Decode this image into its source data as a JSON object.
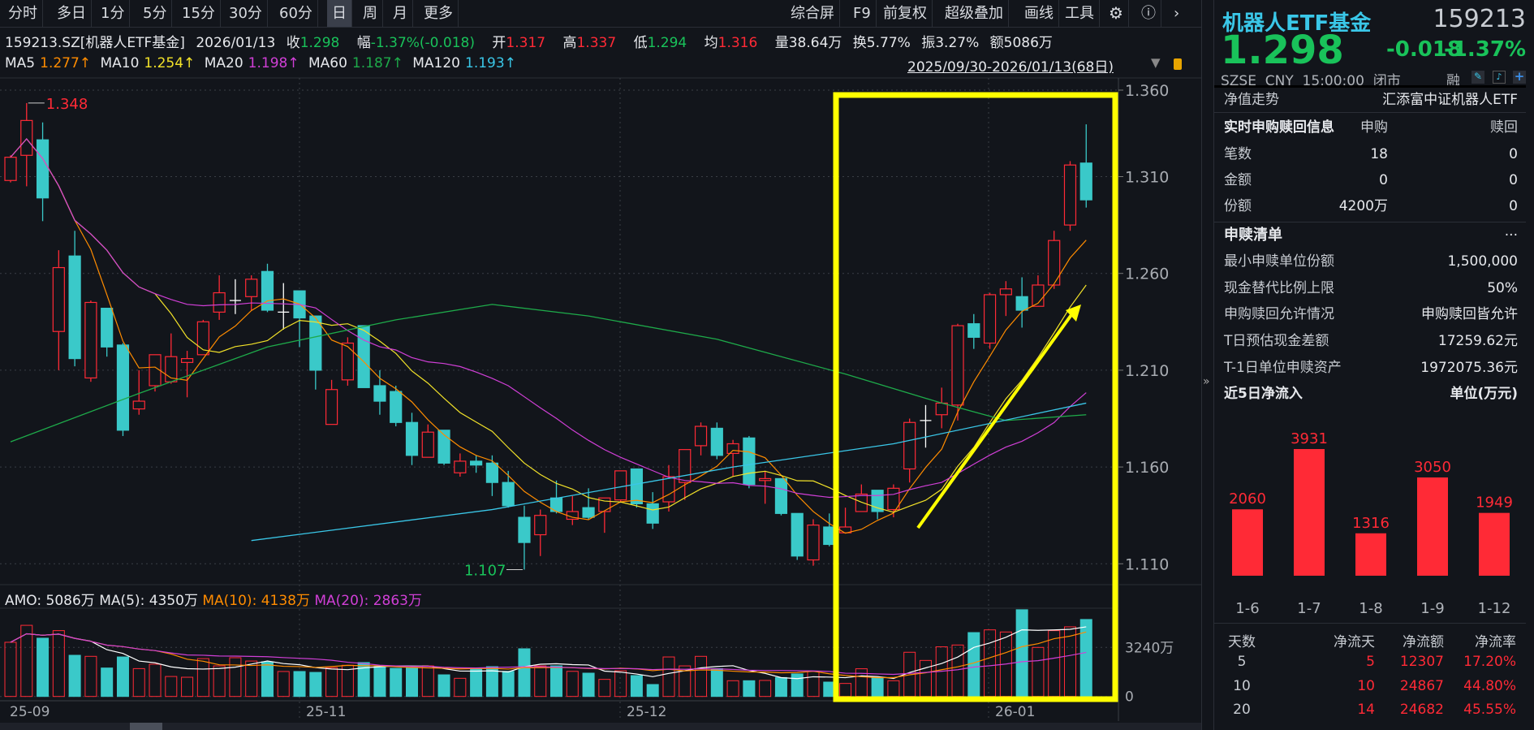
{
  "toolbar": {
    "left": [
      "分时",
      "多日",
      "1分",
      "5分",
      "15分",
      "30分",
      "60分",
      "日",
      "周",
      "月",
      "更多"
    ],
    "active": "日",
    "right": [
      "综合屏",
      "F9",
      "前复权",
      "超级叠加",
      "画线",
      "工具"
    ],
    "icons": [
      "gear-icon",
      "help-icon",
      "chevron-right-icon"
    ]
  },
  "info": {
    "code": "159213.SZ[机器人ETF基金]",
    "date": "2026/01/13",
    "close_label": "收",
    "close": "1.298",
    "chg_label": "幅",
    "chg": "-1.37%(-0.018)",
    "open_label": "开",
    "open": "1.317",
    "high_label": "高",
    "high": "1.337",
    "low_label": "低",
    "low": "1.294",
    "avg_label": "均",
    "avg": "1.316",
    "vol": "量38.64万",
    "turnover": "换5.77%",
    "amp": "振3.27%",
    "amount": "额5086万"
  },
  "ma": {
    "ma5_label": "MA5",
    "ma5": "1.277↑",
    "ma10_label": "MA10",
    "ma10": "1.254↑",
    "ma20_label": "MA20",
    "ma20": "1.198↑",
    "ma60_label": "MA60",
    "ma60": "1.187↑",
    "ma120_label": "MA120",
    "ma120": "1.193↑",
    "range": "2025/09/30-2026/01/13(68日)"
  },
  "colors": {
    "up": "#ff2a36",
    "down": "#3ac9c9",
    "ma5": "#ff8c00",
    "ma10": "#f2e229",
    "ma20": "#d03fd6",
    "ma60": "#1eaa4a",
    "ma120": "#3ac7e8",
    "highlight": "#ffff00"
  },
  "chart_data": {
    "type": "candlestick",
    "price_axis": {
      "ticks": [
        "1.360",
        "1.310",
        "1.260",
        "1.210",
        "1.160",
        "1.110"
      ]
    },
    "high_mark": "1.348",
    "low_mark": "1.107",
    "date_ticks": [
      {
        "label": "25-09",
        "index": 0
      },
      {
        "label": "25-11",
        "index": 18
      },
      {
        "label": "25-12",
        "index": 38
      },
      {
        "label": "26-01",
        "index": 61
      }
    ],
    "ohlc": [
      [
        1.308,
        1.321,
        1.307,
        1.32
      ],
      [
        1.321,
        1.348,
        1.305,
        1.339
      ],
      [
        1.329,
        1.338,
        1.287,
        1.299
      ],
      [
        1.23,
        1.272,
        1.21,
        1.263
      ],
      [
        1.269,
        1.282,
        1.212,
        1.216
      ],
      [
        1.206,
        1.246,
        1.204,
        1.245
      ],
      [
        1.242,
        1.242,
        1.217,
        1.222
      ],
      [
        1.223,
        1.224,
        1.176,
        1.179
      ],
      [
        1.19,
        1.21,
        1.187,
        1.194
      ],
      [
        1.202,
        1.218,
        1.199,
        1.218
      ],
      [
        1.204,
        1.229,
        1.203,
        1.217
      ],
      [
        1.214,
        1.22,
        1.196,
        1.216
      ],
      [
        1.218,
        1.236,
        1.218,
        1.235
      ],
      [
        1.24,
        1.259,
        1.236,
        1.25
      ],
      [
        1.246,
        1.257,
        1.239,
        1.246
      ],
      [
        1.248,
        1.259,
        1.241,
        1.257
      ],
      [
        1.261,
        1.265,
        1.24,
        1.241
      ],
      [
        1.24,
        1.255,
        1.231,
        1.24
      ],
      [
        1.251,
        1.251,
        1.222,
        1.237
      ],
      [
        1.238,
        1.238,
        1.2,
        1.21
      ],
      [
        1.182,
        1.205,
        1.182,
        1.2
      ],
      [
        1.205,
        1.227,
        1.202,
        1.224
      ],
      [
        1.233,
        1.233,
        1.201,
        1.201
      ],
      [
        1.202,
        1.21,
        1.187,
        1.194
      ],
      [
        1.199,
        1.202,
        1.181,
        1.183
      ],
      [
        1.183,
        1.188,
        1.161,
        1.166
      ],
      [
        1.165,
        1.182,
        1.165,
        1.178
      ],
      [
        1.179,
        1.179,
        1.161,
        1.162
      ],
      [
        1.157,
        1.167,
        1.155,
        1.163
      ],
      [
        1.163,
        1.166,
        1.157,
        1.161
      ],
      [
        1.162,
        1.166,
        1.145,
        1.152
      ],
      [
        1.152,
        1.158,
        1.139,
        1.14
      ],
      [
        1.134,
        1.14,
        1.107,
        1.121
      ],
      [
        1.125,
        1.138,
        1.114,
        1.135
      ],
      [
        1.144,
        1.153,
        1.136,
        1.137
      ],
      [
        1.133,
        1.145,
        1.13,
        1.137
      ],
      [
        1.139,
        1.149,
        1.133,
        1.134
      ],
      [
        1.137,
        1.144,
        1.126,
        1.144
      ],
      [
        1.143,
        1.158,
        1.142,
        1.158
      ],
      [
        1.159,
        1.159,
        1.139,
        1.141
      ],
      [
        1.141,
        1.147,
        1.128,
        1.131
      ],
      [
        1.142,
        1.161,
        1.137,
        1.155
      ],
      [
        1.152,
        1.169,
        1.143,
        1.169
      ],
      [
        1.171,
        1.183,
        1.166,
        1.181
      ],
      [
        1.18,
        1.183,
        1.164,
        1.166
      ],
      [
        1.167,
        1.174,
        1.155,
        1.172
      ],
      [
        1.175,
        1.176,
        1.149,
        1.151
      ],
      [
        1.153,
        1.158,
        1.141,
        1.154
      ],
      [
        1.154,
        1.154,
        1.135,
        1.136
      ],
      [
        1.136,
        1.136,
        1.112,
        1.114
      ],
      [
        1.112,
        1.133,
        1.109,
        1.13
      ],
      [
        1.129,
        1.136,
        1.119,
        1.12
      ],
      [
        1.126,
        1.139,
        1.126,
        1.129
      ],
      [
        1.137,
        1.151,
        1.137,
        1.146
      ],
      [
        1.148,
        1.148,
        1.133,
        1.137
      ],
      [
        1.138,
        1.151,
        1.134,
        1.149
      ],
      [
        1.159,
        1.185,
        1.152,
        1.183
      ],
      [
        1.184,
        1.192,
        1.17,
        1.184
      ],
      [
        1.187,
        1.201,
        1.18,
        1.193
      ],
      [
        1.192,
        1.234,
        1.184,
        1.233
      ],
      [
        1.234,
        1.239,
        1.221,
        1.227
      ],
      [
        1.224,
        1.25,
        1.221,
        1.249
      ],
      [
        1.249,
        1.256,
        1.238,
        1.252
      ],
      [
        1.248,
        1.258,
        1.232,
        1.241
      ],
      [
        1.243,
        1.259,
        1.243,
        1.254
      ],
      [
        1.254,
        1.282,
        1.252,
        1.277
      ],
      [
        1.285,
        1.318,
        1.282,
        1.316
      ],
      [
        1.317,
        1.337,
        1.294,
        1.298
      ]
    ],
    "ma60": [
      [
        0,
        1.173
      ],
      [
        8,
        1.198
      ],
      [
        16,
        1.222
      ],
      [
        24,
        1.236
      ],
      [
        30,
        1.244
      ],
      [
        36,
        1.238
      ],
      [
        44,
        1.226
      ],
      [
        52,
        1.208
      ],
      [
        58,
        1.193
      ],
      [
        62,
        1.184
      ],
      [
        67,
        1.187
      ]
    ],
    "ma120": [
      [
        15,
        1.122
      ],
      [
        30,
        1.138
      ],
      [
        45,
        1.16
      ],
      [
        55,
        1.172
      ],
      [
        67,
        1.193
      ]
    ],
    "volume_wan": [
      3580,
      4700,
      3850,
      4350,
      2720,
      2650,
      1880,
      2610,
      1840,
      2130,
      1320,
      1270,
      2500,
      2020,
      2560,
      2340,
      2290,
      1650,
      1650,
      1590,
      1900,
      2060,
      2240,
      2020,
      1860,
      1880,
      2020,
      1430,
      1200,
      1840,
      1970,
      1660,
      3150,
      2020,
      2020,
      1660,
      1540,
      1130,
      1700,
      1380,
      790,
      2610,
      2020,
      2650,
      1840,
      1040,
      1040,
      1060,
      1250,
      1490,
      1660,
      950,
      860,
      1830,
      1270,
      1040,
      2920,
      2380,
      3280,
      3400,
      4220,
      4400,
      4260,
      5730,
      3240,
      4350,
      4600,
      5086
    ],
    "volume_axis": {
      "ticks": [
        "3240万",
        "0"
      ]
    }
  },
  "amo": {
    "amo": "AMO: 5086万",
    "ma5": "MA(5): 4350万",
    "ma10": "MA(10): 4138万",
    "ma20": "MA(20): 2863万"
  },
  "panel": {
    "name": "机器人ETF基金",
    "code": "159213",
    "price": "1.298",
    "change": "-0.018",
    "pct": "-1.37%",
    "meta": "SZSE  CNY  15:00:00  闭市",
    "rong": "融",
    "nav_label": "净值走势",
    "nav_value": "汇添富中证机器人ETF",
    "sr_title": "实时申购赎回信息",
    "sr_col1": "申购",
    "sr_col2": "赎回",
    "sr_rows": [
      {
        "label": "笔数",
        "buy": "18",
        "sell": "0"
      },
      {
        "label": "金额",
        "buy": "0",
        "sell": "0"
      },
      {
        "label": "份额",
        "buy": "4200万",
        "sell": "0"
      }
    ],
    "list_title": "申赎清单",
    "list_more": "···",
    "list_rows": [
      {
        "label": "最小申赎单位份额",
        "value": "1,500,000"
      },
      {
        "label": "现金替代比例上限",
        "value": "50%"
      },
      {
        "label": "申购赎回允许情况",
        "value": "申购赎回皆允许"
      },
      {
        "label": "T日预估现金差额",
        "value": "17259.62元"
      },
      {
        "label": "T-1日单位申赎资产",
        "value": "1972075.36元"
      }
    ],
    "flow_title": "近5日净流入",
    "flow_unit": "单位(万元)",
    "flow": {
      "categories": [
        "1-6",
        "1-7",
        "1-8",
        "1-9",
        "1-12"
      ],
      "values": [
        2060,
        3931,
        1316,
        3050,
        1949
      ],
      "labels": [
        "2060",
        "3931",
        "1316",
        "3050",
        "1949"
      ]
    },
    "table_header": [
      "天数",
      "净流天",
      "净流额",
      "净流率"
    ],
    "table_rows": [
      [
        "5",
        "5",
        "12307",
        "17.20%"
      ],
      [
        "10",
        "10",
        "24867",
        "44.80%"
      ],
      [
        "20",
        "14",
        "24682",
        "45.55%"
      ]
    ]
  }
}
